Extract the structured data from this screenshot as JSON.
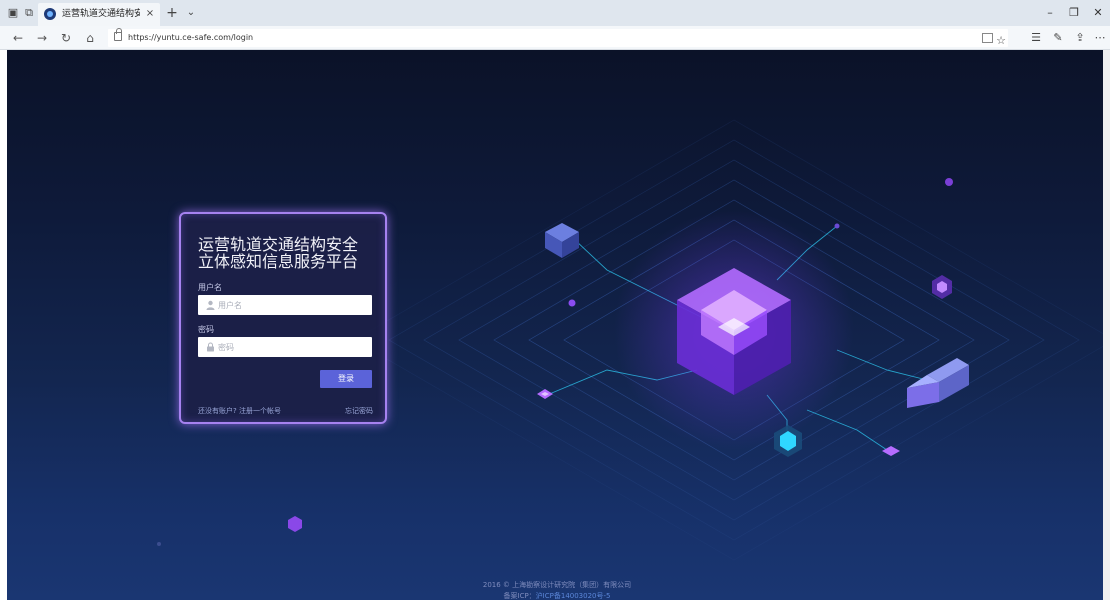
{
  "browser": {
    "tab_title": "运营轨道交通结构安全",
    "tab_close": "×",
    "new_tab": "+",
    "tab_list": "⌄",
    "url": "https://yuntu.ce-safe.com/login",
    "icons": [
      "sets-aside-icon",
      "tab-preview-icon",
      "back-icon",
      "forward-icon",
      "refresh-icon",
      "home-icon",
      "lock-icon",
      "reading-view-icon",
      "favorite-star-icon",
      "favorites-hub-icon",
      "notes-icon",
      "share-icon",
      "more-icon"
    ],
    "window_controls": {
      "minimize": "–",
      "restore": "❐",
      "close": "✕"
    }
  },
  "login": {
    "title": "运营轨道交通结构安全\n立体感知信息服务平台",
    "username_label": "用户名",
    "username_placeholder": "用户名",
    "password_label": "密码",
    "password_placeholder": "密码",
    "login_button": "登录",
    "register_link": "还没有账户? 注册一个帐号",
    "forgot_link": "忘记密码"
  },
  "footer": {
    "copyright": "2016 © 上海勘察设计研究院（集团）有限公司",
    "icp_prefix": "备案ICP：",
    "icp_number": "沪ICP备14003020号-5"
  },
  "colors": {
    "background_top": "#0b1228",
    "background_bottom": "#1a3672",
    "card_border": "#a682f0",
    "login_button": "#5b63d9",
    "accent_cyan": "#2fd7ff",
    "accent_purple": "#9b4dff"
  }
}
